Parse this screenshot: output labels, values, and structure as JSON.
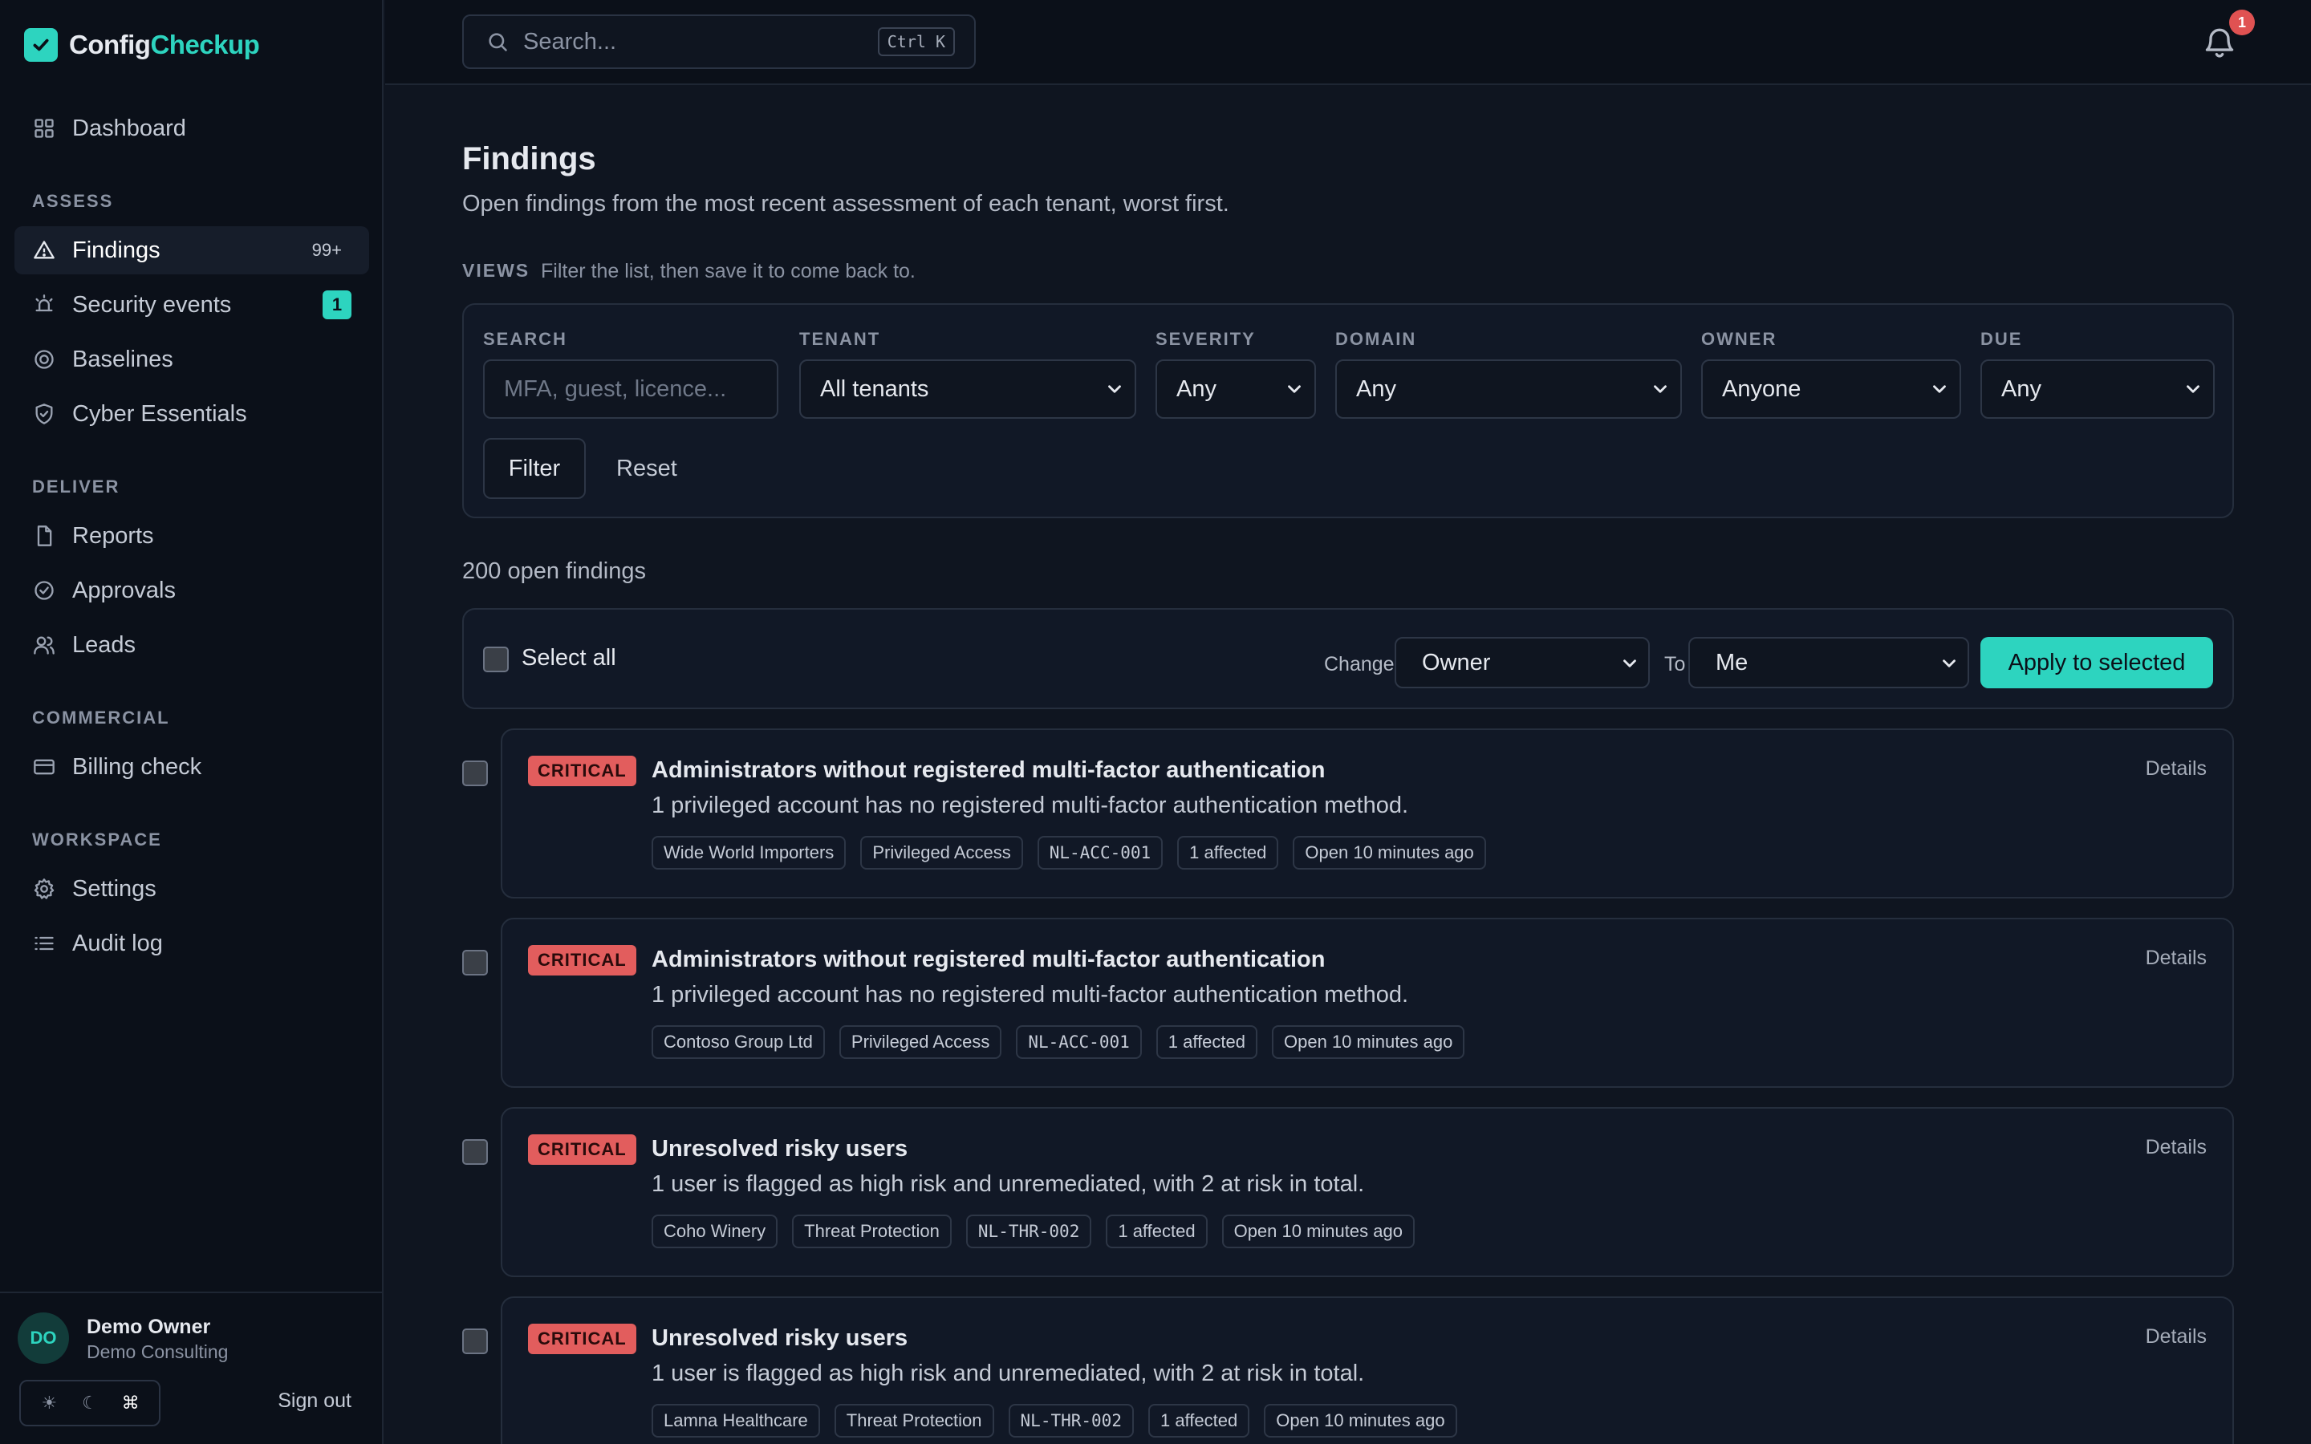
{
  "app": {
    "name_part1": "Config",
    "name_part2": "Checkup",
    "accent": "#2dd4bf"
  },
  "sidebar": {
    "dashboard": "Dashboard",
    "sections": {
      "assess": "ASSESS",
      "deliver": "DELIVER",
      "commercial": "COMMERCIAL",
      "workspace": "WORKSPACE"
    },
    "findings": {
      "label": "Findings",
      "count": "99+"
    },
    "security_events": {
      "label": "Security events",
      "badge": "1"
    },
    "baselines": "Baselines",
    "cyber_essentials": "Cyber Essentials",
    "reports": "Reports",
    "approvals": "Approvals",
    "leads": "Leads",
    "billing_check": "Billing check",
    "settings": "Settings",
    "audit_log": "Audit log",
    "user": {
      "initials": "DO",
      "name": "Demo Owner",
      "org": "Demo Consulting"
    },
    "theme": {
      "light": "☀",
      "dark": "☾",
      "system": "⌘"
    },
    "sign_out": "Sign out"
  },
  "topbar": {
    "search_placeholder": "Search...",
    "shortcut": "Ctrl K",
    "notification_count": "1"
  },
  "page": {
    "title": "Findings",
    "subtitle": "Open findings from the most recent assessment of each tenant, worst first.",
    "views_label": "VIEWS",
    "views_hint": "Filter the list, then save it to come back to."
  },
  "filters": {
    "search": {
      "label": "SEARCH",
      "placeholder": "MFA, guest, licence..."
    },
    "tenant": {
      "label": "TENANT",
      "value": "All tenants"
    },
    "severity": {
      "label": "SEVERITY",
      "value": "Any"
    },
    "domain": {
      "label": "DOMAIN",
      "value": "Any"
    },
    "owner": {
      "label": "OWNER",
      "value": "Anyone"
    },
    "due": {
      "label": "DUE",
      "value": "Any"
    },
    "filter_button": "Filter",
    "reset_button": "Reset"
  },
  "results": {
    "count_text": "200 open findings"
  },
  "bulk": {
    "select_all": "Select all",
    "change_label": "Change",
    "change_value": "Owner",
    "to_label": "To",
    "to_value": "Me",
    "apply": "Apply to selected"
  },
  "findings": [
    {
      "severity": "CRITICAL",
      "title": "Administrators without registered multi-factor authentication",
      "description": "1 privileged account has no registered multi-factor authentication method.",
      "tenant": "Wide World Importers",
      "domain": "Privileged Access",
      "code": "NL-ACC-001",
      "affected": "1 affected",
      "age": "Open 10 minutes ago",
      "details": "Details"
    },
    {
      "severity": "CRITICAL",
      "title": "Administrators without registered multi-factor authentication",
      "description": "1 privileged account has no registered multi-factor authentication method.",
      "tenant": "Contoso Group Ltd",
      "domain": "Privileged Access",
      "code": "NL-ACC-001",
      "affected": "1 affected",
      "age": "Open 10 minutes ago",
      "details": "Details"
    },
    {
      "severity": "CRITICAL",
      "title": "Unresolved risky users",
      "description": "1 user is flagged as high risk and unremediated, with 2 at risk in total.",
      "tenant": "Coho Winery",
      "domain": "Threat Protection",
      "code": "NL-THR-002",
      "affected": "1 affected",
      "age": "Open 10 minutes ago",
      "details": "Details"
    },
    {
      "severity": "CRITICAL",
      "title": "Unresolved risky users",
      "description": "1 user is flagged as high risk and unremediated, with 2 at risk in total.",
      "tenant": "Lamna Healthcare",
      "domain": "Threat Protection",
      "code": "NL-THR-002",
      "affected": "1 affected",
      "age": "Open 10 minutes ago",
      "details": "Details"
    }
  ]
}
